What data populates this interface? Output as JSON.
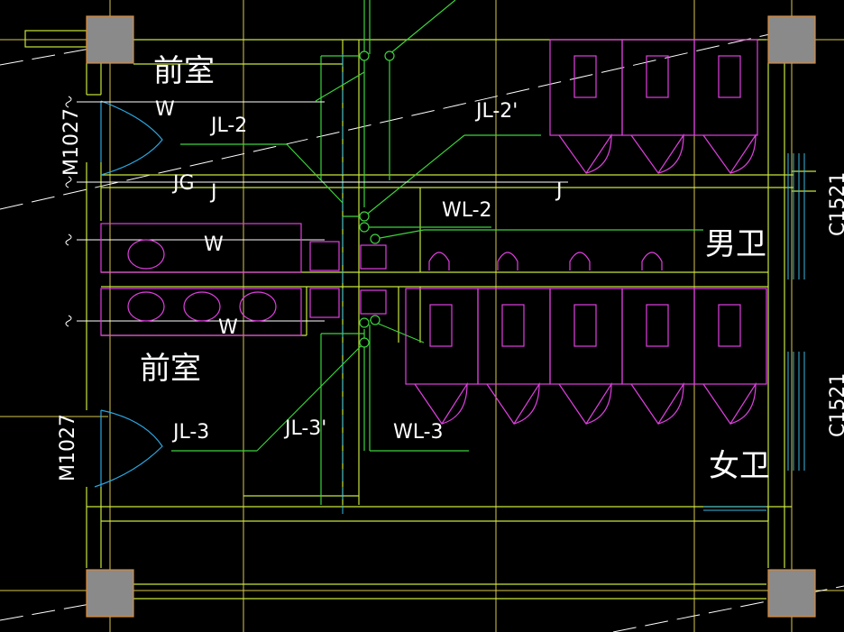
{
  "colors": {
    "background": "#000000",
    "wall": "#c8e63c",
    "grid_axis": "#d9c84a",
    "water_pipe": "#3cd23c",
    "fixture": "#e040e0",
    "column_fill": "#8a8a8a",
    "column_edge": "#d98a3a",
    "window": "#39b8e0",
    "door_arc": "#2aa6e0",
    "text": "#ffffff"
  },
  "rooms": {
    "anteroom_top": "前室",
    "anteroom_bottom": "前室",
    "mens": "男卫",
    "womens": "女卫"
  },
  "doors": {
    "door_upper": "M1027",
    "door_lower": "M1027"
  },
  "windows": {
    "window_upper": "C1521",
    "window_lower": "C1521"
  },
  "pipe_labels": {
    "jl2": "JL-2",
    "jl2p": "JL-2'",
    "jg": "JG",
    "j_left": "J",
    "j_right": "J",
    "wl2": "WL-2",
    "jl3": "JL-3",
    "jl3p": "JL-3'",
    "wl3": "WL-3"
  },
  "drain_labels": {
    "w_top": "W",
    "w_mid": "W",
    "w_low": "W"
  }
}
